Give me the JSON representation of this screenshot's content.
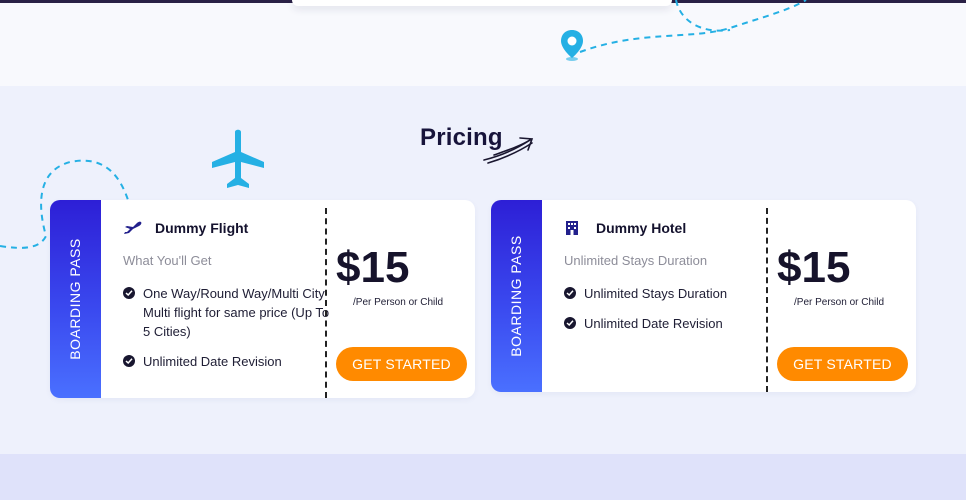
{
  "section": {
    "title": "Pricing"
  },
  "colors": {
    "accent": "#ff8a00",
    "stub_gradient_start": "#2d1fd6",
    "stub_gradient_end": "#4a70ff",
    "decor_blue": "#25b0e4",
    "heading": "#17143b"
  },
  "icons": {
    "plane": "airplane-icon",
    "pin": "location-pin-icon",
    "arrow": "swoosh-arrow-icon",
    "flight": "flight-icon",
    "hotel": "hotel-icon",
    "check": "check-circle-icon"
  },
  "plans": [
    {
      "stub_label": "BOARDING PASS",
      "name": "Dummy Flight",
      "subtitle": "What You'll Get",
      "features": [
        "One Way/Round Way/Multi City Multi flight for same price (Up To 5 Cities)",
        "Unlimited Date Revision"
      ],
      "price": "$15",
      "price_note": "/Per Person or Child",
      "cta": "GET STARTED"
    },
    {
      "stub_label": "BOARDING PASS",
      "name": "Dummy Hotel",
      "subtitle": "Unlimited Stays Duration",
      "features": [
        "Unlimited Stays Duration",
        "Unlimited Date Revision"
      ],
      "price": "$15",
      "price_note": "/Per Person or Child",
      "cta": "GET STARTED"
    }
  ]
}
